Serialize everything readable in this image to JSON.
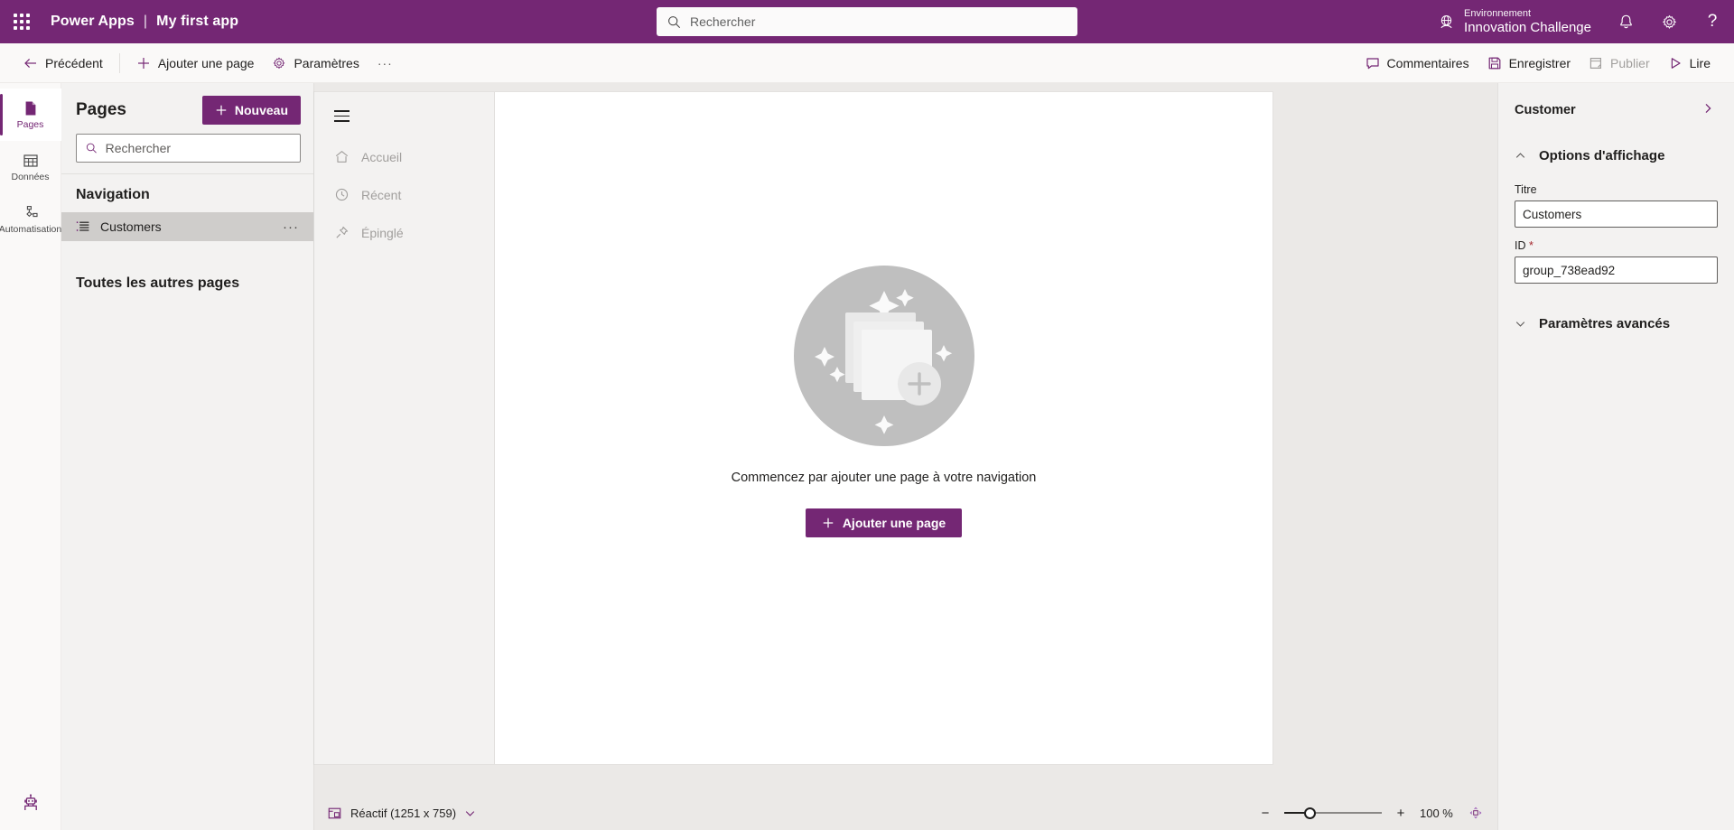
{
  "topbar": {
    "waffle_label": "app-launcher",
    "product": "Power Apps",
    "separator": "|",
    "app_name": "My first app",
    "search_placeholder": "Rechercher",
    "search_value": "",
    "environment_label": "Environnement",
    "environment_name": "Innovation Challenge",
    "notifications_label": "Notifications",
    "settings_label": "Paramètres",
    "help_label": "Aide"
  },
  "commandbar": {
    "back": "Précédent",
    "add_page": "Ajouter une page",
    "settings": "Paramètres",
    "overflow": "···",
    "comments": "Commentaires",
    "save": "Enregistrer",
    "publish": "Publier",
    "play": "Lire"
  },
  "rail": {
    "items": [
      {
        "label": "Pages",
        "icon": "pages-icon",
        "active": true
      },
      {
        "label": "Données",
        "icon": "data-grid-icon",
        "active": false
      },
      {
        "label": "Automatisation",
        "icon": "automation-icon",
        "active": false
      }
    ],
    "bottom_icon": "copilot-robot-icon"
  },
  "pages_panel": {
    "title": "Pages",
    "new_button": "Nouveau",
    "search_placeholder": "Rechercher",
    "search_value": "",
    "navigation_group": "Navigation",
    "nav_items": [
      {
        "label": "Customers",
        "icon": "list-icon",
        "selected": true,
        "more": "···"
      }
    ],
    "other_pages_group": "Toutes les autres pages"
  },
  "app_preview": {
    "hamburger": "menu-icon",
    "nav_items": [
      {
        "label": "Accueil",
        "icon": "home-icon"
      },
      {
        "label": "Récent",
        "icon": "clock-icon"
      },
      {
        "label": "Épinglé",
        "icon": "pin-icon"
      }
    ],
    "empty_state": {
      "illustration": "add-pages-illustration",
      "message": "Commencez par ajouter une page à votre navigation",
      "button": "Ajouter une page"
    }
  },
  "statusbar": {
    "layout_icon": "responsive-layout-icon",
    "layout_label": "Réactif (1251 x 759)",
    "chevron": "chevron-down-icon",
    "zoom_out": "−",
    "zoom_in": "+",
    "zoom_level": "100 %",
    "fit_icon": "fit-to-screen-icon"
  },
  "properties": {
    "title": "Customer",
    "collapse_icon": "chevron-right-icon",
    "display_options": {
      "label": "Options d'affichage",
      "expanded": true,
      "fields": [
        {
          "label": "Titre",
          "value": "Customers",
          "required": false
        },
        {
          "label": "ID",
          "value": "group_738ead92",
          "required": true,
          "required_mark": "*"
        }
      ]
    },
    "advanced": {
      "label": "Paramètres avancés",
      "expanded": false
    }
  },
  "colors": {
    "brand_purple": "#742774",
    "command_bar_bg": "#faf9f8",
    "panel_bg": "#f3f2f1",
    "canvas_bg": "#ebe9e7",
    "selected_row": "#cfcdcb"
  }
}
